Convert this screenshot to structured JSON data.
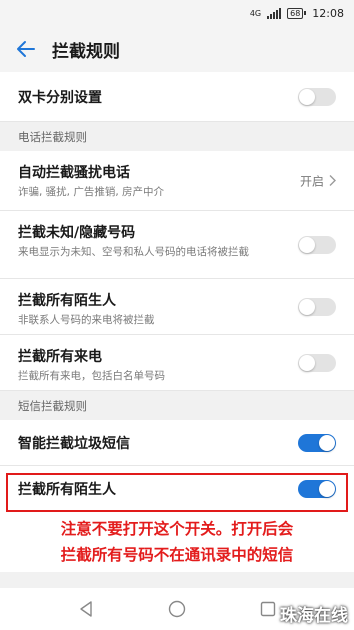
{
  "status_bar": {
    "network": "4G",
    "battery": "68",
    "time": "12:08"
  },
  "app_bar": {
    "title": "拦截规则",
    "back_icon": "arrow-left-icon"
  },
  "items": {
    "dual_sim": {
      "title": "双卡分别设置",
      "enabled": false
    },
    "call_section": "电话拦截规则",
    "auto_block": {
      "title": "自动拦截骚扰电话",
      "subtitle": "诈骗, 骚扰, 广告推销, 房产中介",
      "value": "开启"
    },
    "unknown": {
      "title": "拦截未知/隐藏号码",
      "subtitle": "来电显示为未知、空号和私人号码的电话将被拦截",
      "enabled": false
    },
    "strangers_call": {
      "title": "拦截所有陌生人",
      "subtitle": "非联系人号码的来电将被拦截",
      "enabled": false
    },
    "all_calls": {
      "title": "拦截所有来电",
      "subtitle": "拦截所有来电，包括白名单号码",
      "enabled": false
    },
    "sms_section": "短信拦截规则",
    "smart_sms": {
      "title": "智能拦截垃圾短信",
      "enabled": true
    },
    "strangers_sms": {
      "title": "拦截所有陌生人",
      "enabled": true
    }
  },
  "annotation": {
    "line1": "注意不要打开这个开关。打开后会",
    "line2": "拦截所有号码不在通讯录中的短信"
  },
  "watermark": "珠海在线",
  "colors": {
    "accent": "#1f76d8",
    "annotation": "#e31c1c"
  }
}
